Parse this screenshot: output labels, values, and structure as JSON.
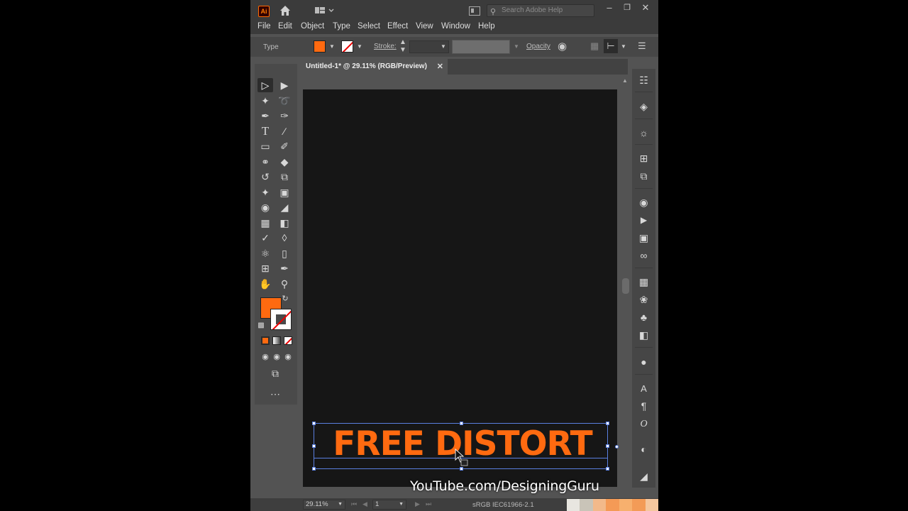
{
  "titlebar": {
    "app_logo": "Ai",
    "search_placeholder": "Search Adobe Help",
    "window_controls": [
      "minimize-icon",
      "restore-icon",
      "close-icon"
    ]
  },
  "menubar": {
    "items": [
      "File",
      "Edit",
      "Object",
      "Type",
      "Select",
      "Effect",
      "View",
      "Window",
      "Help"
    ]
  },
  "control_bar": {
    "selection_type": "Type",
    "fill_color": "#ff6a10",
    "stroke_label": "Stroke:",
    "opacity_label": "Opacity"
  },
  "document": {
    "tab_title": "Untitled-1* @ 29.11% (RGB/Preview)",
    "canvas_color": "#161616"
  },
  "artwork": {
    "headline": "FREE DISTORT",
    "text_color": "#ff6a10"
  },
  "statusbar": {
    "zoom": "29.11%",
    "artboard": "1",
    "color_profile": "sRGB IEC61966-2.1"
  },
  "watermark": {
    "text": "YouTube.com/DesigningGuru"
  },
  "colors": {
    "accent": "#ff6a10",
    "ui_dark": "#3b3b3b",
    "ui_mid": "#535353",
    "selection_blue": "#5a7fe0"
  }
}
